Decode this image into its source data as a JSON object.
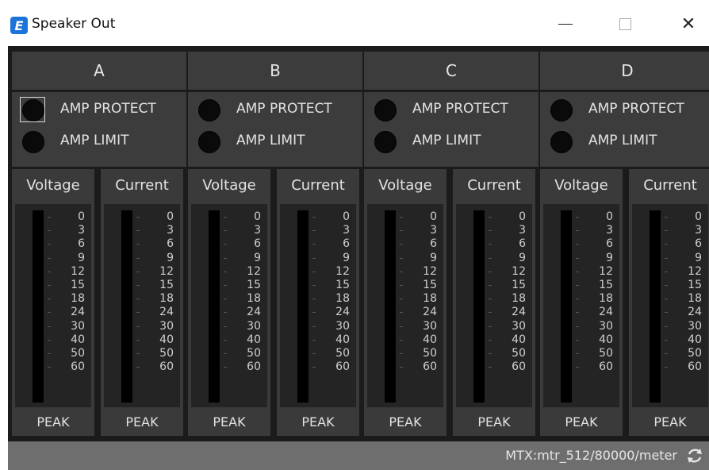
{
  "window": {
    "title": "Speaker Out",
    "app_icon_glyph": "E",
    "close_glyph": "✕"
  },
  "channels": [
    {
      "name": "A",
      "amp_protect": "AMP PROTECT",
      "amp_limit": "AMP LIMIT",
      "voltage": "Voltage",
      "current": "Current",
      "peak_v": "PEAK",
      "peak_c": "PEAK"
    },
    {
      "name": "B",
      "amp_protect": "AMP PROTECT",
      "amp_limit": "AMP LIMIT",
      "voltage": "Voltage",
      "current": "Current",
      "peak_v": "PEAK",
      "peak_c": "PEAK"
    },
    {
      "name": "C",
      "amp_protect": "AMP PROTECT",
      "amp_limit": "AMP LIMIT",
      "voltage": "Voltage",
      "current": "Current",
      "peak_v": "PEAK",
      "peak_c": "PEAK"
    },
    {
      "name": "D",
      "amp_protect": "AMP PROTECT",
      "amp_limit": "AMP LIMIT",
      "voltage": "Voltage",
      "current": "Current",
      "peak_v": "PEAK",
      "peak_c": "PEAK"
    }
  ],
  "meter_scale": [
    "0",
    "3",
    "6",
    "9",
    "12",
    "15",
    "18",
    "24",
    "30",
    "40",
    "50",
    "60"
  ],
  "status": {
    "path": "MTX:mtr_512/80000/meter"
  },
  "colors": {
    "background": "#1b1b1b",
    "panel": "#3c3c3c",
    "meter_bg": "#242424",
    "led_off": "#0a0a0a",
    "statusbar": "#6e6e6e",
    "app_icon": "#1a74d9"
  }
}
